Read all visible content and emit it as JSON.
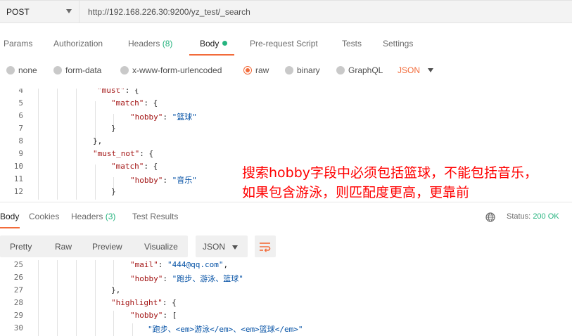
{
  "request": {
    "method": "POST",
    "url": "http://192.168.226.30:9200/yz_test/_search"
  },
  "request_tabs": {
    "params": "Params",
    "authorization": "Authorization",
    "headers": "Headers",
    "headers_count": "(8)",
    "body": "Body",
    "prerequest": "Pre-request Script",
    "tests": "Tests",
    "settings": "Settings"
  },
  "body_types": {
    "none": "none",
    "form_data": "form-data",
    "urlencoded": "x-www-form-urlencoded",
    "raw": "raw",
    "binary": "binary",
    "graphql": "GraphQL",
    "format": "JSON",
    "selected": "raw"
  },
  "request_code": [
    {
      "n": "4",
      "parts": [
        [
          "k",
          "\"must\""
        ],
        [
          "p",
          ": {"
        ]
      ]
    },
    {
      "n": "5",
      "parts": [
        [
          "k",
          "\"match\""
        ],
        [
          "p",
          ": {"
        ]
      ]
    },
    {
      "n": "6",
      "parts": [
        [
          "k",
          "\"hobby\""
        ],
        [
          "p",
          ": "
        ],
        [
          "s",
          "\"篮球\""
        ]
      ]
    },
    {
      "n": "7",
      "parts": [
        [
          "p",
          "}"
        ]
      ]
    },
    {
      "n": "8",
      "parts": [
        [
          "p",
          "},"
        ]
      ]
    },
    {
      "n": "9",
      "parts": [
        [
          "k",
          "\"must_not\""
        ],
        [
          "p",
          ": {"
        ]
      ]
    },
    {
      "n": "10",
      "parts": [
        [
          "k",
          "\"match\""
        ],
        [
          "p",
          ": {"
        ]
      ]
    },
    {
      "n": "11",
      "parts": [
        [
          "k",
          "\"hobby\""
        ],
        [
          "p",
          ": "
        ],
        [
          "s",
          "\"音乐\""
        ]
      ]
    },
    {
      "n": "12",
      "parts": [
        [
          "p",
          "}"
        ]
      ]
    }
  ],
  "annotation": {
    "line1": "搜索hobby字段中必须包括篮球，不能包括音乐，",
    "line2": "如果包含游泳，则匹配度更高，更靠前"
  },
  "response_tabs": {
    "body": "Body",
    "cookies": "Cookies",
    "headers": "Headers",
    "headers_count": "(3)",
    "test_results": "Test Results"
  },
  "status": {
    "label": "Status:",
    "value": "200 OK"
  },
  "view_tabs": {
    "pretty": "Pretty",
    "raw": "Raw",
    "preview": "Preview",
    "visualize": "Visualize",
    "format": "JSON"
  },
  "response_code": [
    {
      "n": "25",
      "parts": [
        [
          "k",
          "\"mail\""
        ],
        [
          "p",
          ": "
        ],
        [
          "s",
          "\"444@qq.com\""
        ],
        [
          "p",
          ","
        ]
      ]
    },
    {
      "n": "26",
      "parts": [
        [
          "k",
          "\"hobby\""
        ],
        [
          "p",
          ": "
        ],
        [
          "s",
          "\"跑步、游泳、篮球\""
        ]
      ]
    },
    {
      "n": "27",
      "parts": [
        [
          "p",
          "},"
        ]
      ]
    },
    {
      "n": "28",
      "parts": [
        [
          "k",
          "\"highlight\""
        ],
        [
          "p",
          ": {"
        ]
      ]
    },
    {
      "n": "29",
      "parts": [
        [
          "k",
          "\"hobby\""
        ],
        [
          "p",
          ": ["
        ]
      ]
    },
    {
      "n": "30",
      "parts": [
        [
          "s",
          "\"跑步、<em>游泳</em>、<em>篮球</em>\""
        ]
      ]
    }
  ],
  "colors": {
    "accent": "#f26b3a",
    "green": "#26b47f",
    "annotation": "#ff0000",
    "key": "#a31515",
    "string": "#0451a5"
  }
}
